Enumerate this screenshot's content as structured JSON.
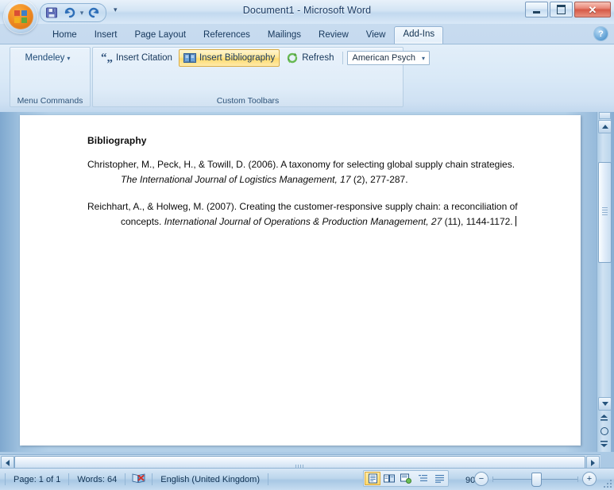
{
  "window": {
    "title": "Document1 - Microsoft Word",
    "minimize_label": "Minimize",
    "maximize_label": "Maximize",
    "close_label": "✕"
  },
  "quick_access": {
    "save_label": "save-icon",
    "undo_label": "undo-icon",
    "redo_label": "redo-icon",
    "undo_caret": "▾",
    "customize_caret": "▾"
  },
  "ribbon": {
    "tabs": [
      {
        "label": "Home",
        "active": false
      },
      {
        "label": "Insert",
        "active": false
      },
      {
        "label": "Page Layout",
        "active": false
      },
      {
        "label": "References",
        "active": false
      },
      {
        "label": "Mailings",
        "active": false
      },
      {
        "label": "Review",
        "active": false
      },
      {
        "label": "View",
        "active": false
      },
      {
        "label": "Add-Ins",
        "active": true
      }
    ],
    "help_label": "?",
    "groups": {
      "menu_commands": {
        "label": "Menu Commands",
        "button_label": "Mendeley",
        "button_caret": "▾"
      },
      "custom_toolbars": {
        "label": "Custom Toolbars",
        "insert_citation_label": "Insert Citation",
        "insert_bibliography_label": "Insert Bibliography",
        "refresh_label": "Refresh",
        "style_value": "American Psych",
        "style_caret": "▾"
      }
    }
  },
  "document": {
    "heading": "Bibliography",
    "references": [
      {
        "prefix": "Christopher, M., Peck, H., & Towill, D. (2006). A taxonomy for selecting global supply chain strategies. ",
        "italic": "The International Journal of Logistics Management, 17",
        "suffix": " (2), 277-287."
      },
      {
        "prefix": "Reichhart, A., & Holweg, M. (2007). Creating the customer-responsive supply chain: a reconciliation of concepts. ",
        "italic": "International Journal of Operations & Production Management, 27",
        "suffix": " (11), 1144-1172."
      }
    ]
  },
  "status_bar": {
    "page_label": "Page: 1 of 1",
    "words_label": "Words: 64",
    "proofing_label": "proofing-errors-icon",
    "language_label": "English (United Kingdom)",
    "view_buttons": [
      {
        "name": "print-layout",
        "active": true
      },
      {
        "name": "full-screen-reading",
        "active": false
      },
      {
        "name": "web-layout",
        "active": false
      },
      {
        "name": "outline",
        "active": false
      },
      {
        "name": "draft",
        "active": false
      }
    ],
    "zoom_level": "90%",
    "zoom_out_label": "−",
    "zoom_in_label": "+"
  }
}
